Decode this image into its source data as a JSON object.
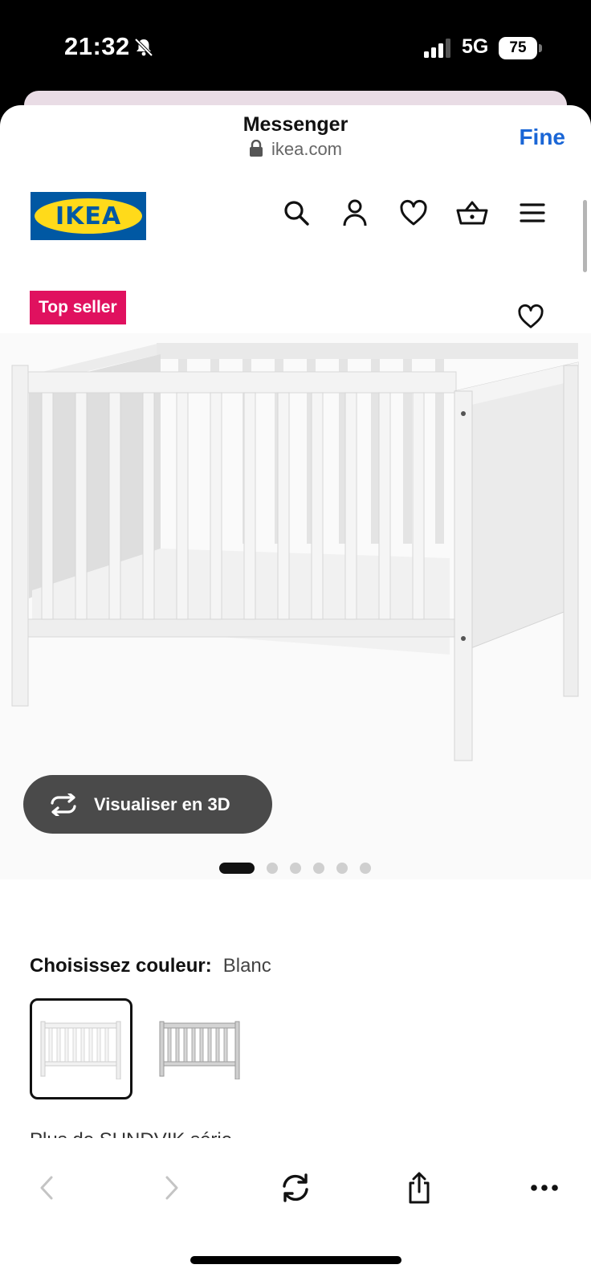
{
  "status_bar": {
    "time": "21:32",
    "network": "5G",
    "battery": "75",
    "icons": [
      "bell-slash-icon",
      "signal-icon"
    ]
  },
  "browser": {
    "title": "Messenger",
    "url": "ikea.com",
    "done_label": "Fine"
  },
  "site_header": {
    "logo_text": "IKEA",
    "icons": [
      "search-icon",
      "account-icon",
      "heart-icon",
      "basket-icon",
      "menu-icon"
    ]
  },
  "product": {
    "badge": "Top seller",
    "view_3d_label": "Visualiser en 3D",
    "carousel": {
      "total": 6,
      "active_index": 0
    },
    "color_label": "Choisissez couleur:",
    "color_value": "Blanc",
    "swatches": [
      {
        "name": "Blanc",
        "selected": true
      },
      {
        "name": "Gris",
        "selected": false
      }
    ],
    "series_text": "Plus de SUNDVIK série"
  },
  "toolbar": {
    "icons": [
      "back-icon",
      "forward-icon",
      "reload-icon",
      "share-icon",
      "more-icon"
    ]
  },
  "colors": {
    "ikea_blue": "#0058a3",
    "ikea_yellow": "#ffda1a",
    "badge_red": "#e0115f",
    "link_blue": "#1a66d6"
  }
}
